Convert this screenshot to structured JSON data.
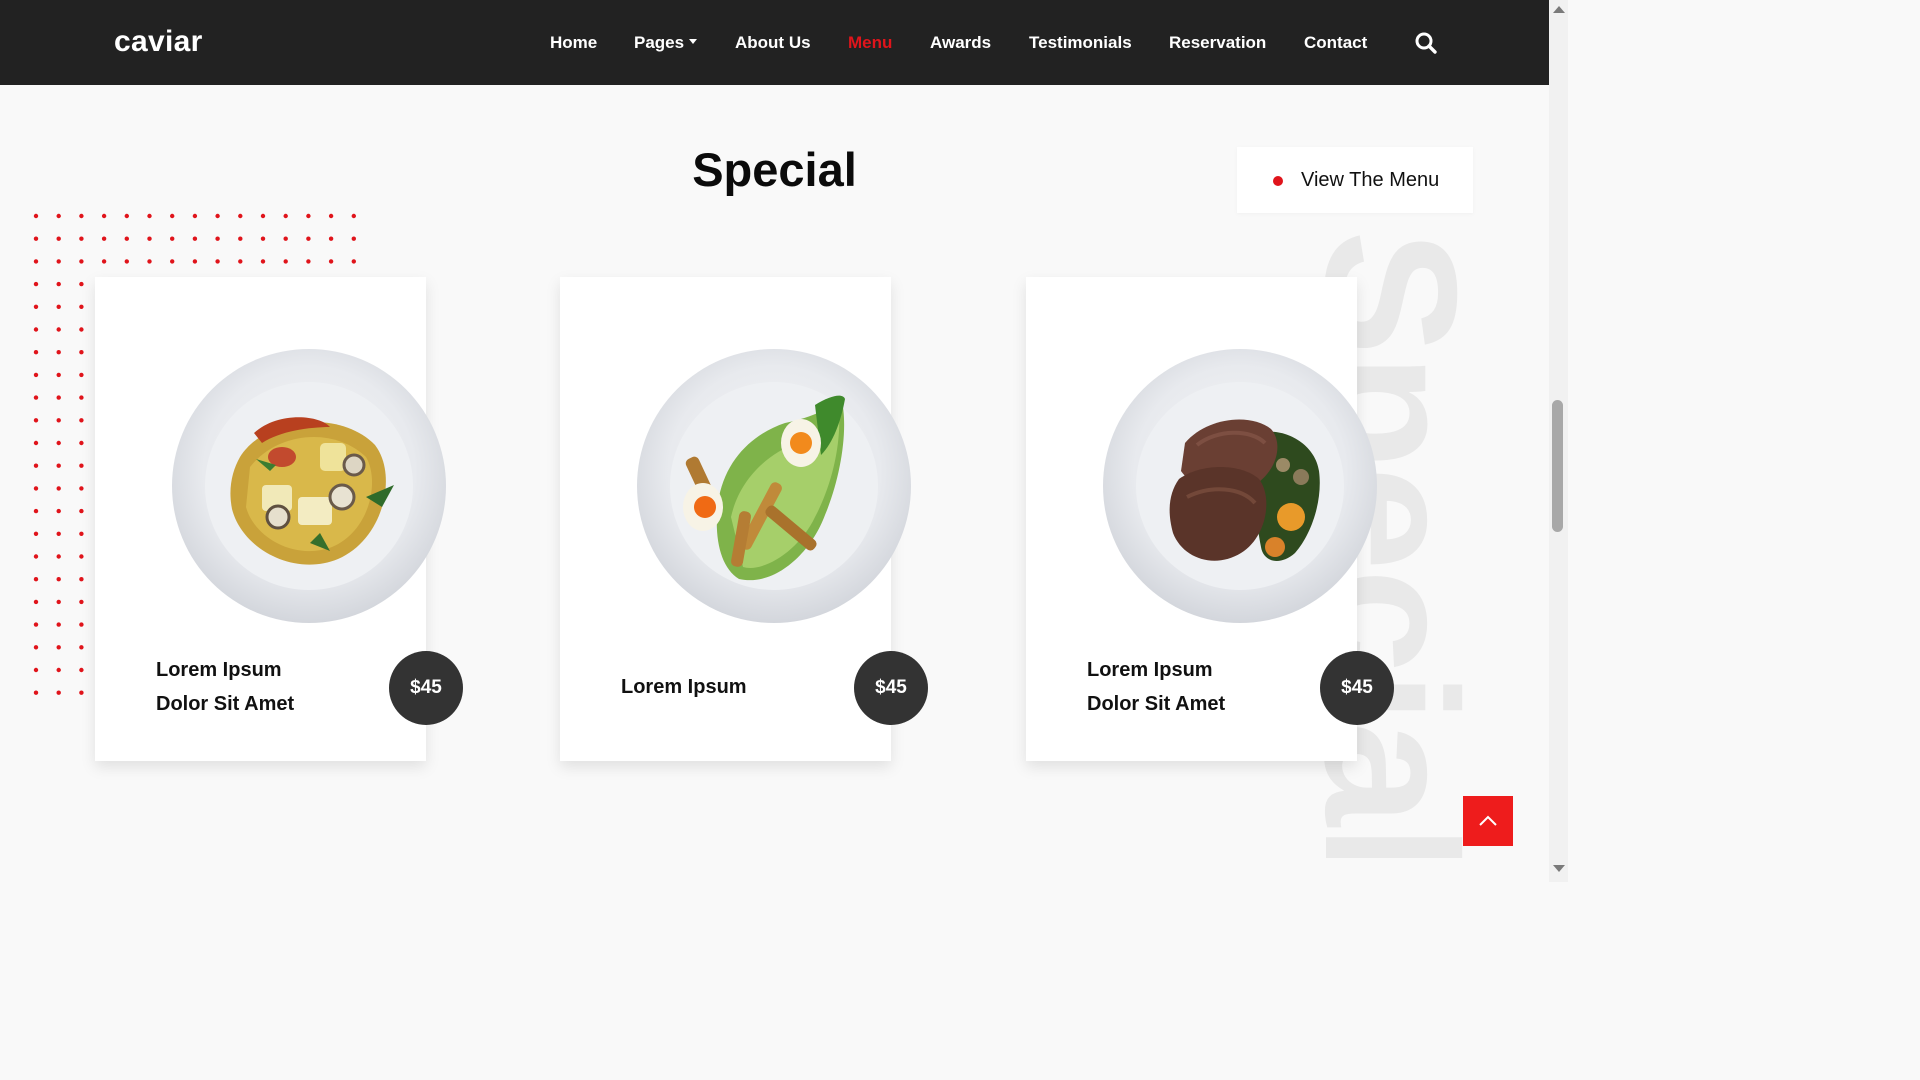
{
  "brand": {
    "name": "caviar"
  },
  "nav": {
    "items": [
      {
        "label": "Home"
      },
      {
        "label": "Pages"
      },
      {
        "label": "About Us"
      },
      {
        "label": "Menu"
      },
      {
        "label": "Awards"
      },
      {
        "label": "Testimonials"
      },
      {
        "label": "Reservation"
      },
      {
        "label": "Contact"
      }
    ],
    "active": "Menu",
    "search_icon": "search-icon"
  },
  "section": {
    "title": "Special",
    "watermark": "Special",
    "view_menu_label": "View The Menu"
  },
  "cards": [
    {
      "name_line1": "Lorem Ipsum",
      "name_line2": "Dolor Sit Amet",
      "price": "$45",
      "dish": "seafood-stew"
    },
    {
      "name_line1": "Lorem Ipsum",
      "name_line2": "",
      "price": "$45",
      "dish": "caesar-salad"
    },
    {
      "name_line1": "Lorem Ipsum",
      "name_line2": "Dolor Sit Amet",
      "price": "$45",
      "dish": "steak-with-greens"
    }
  ],
  "colors": {
    "accent": "#e0141b",
    "navbar": "#222222",
    "price_badge": "#333333",
    "back_to_top": "#ee1c1c"
  },
  "icons": {
    "back_to_top": "chevron-up-icon",
    "dropdown": "caret-down-icon"
  }
}
